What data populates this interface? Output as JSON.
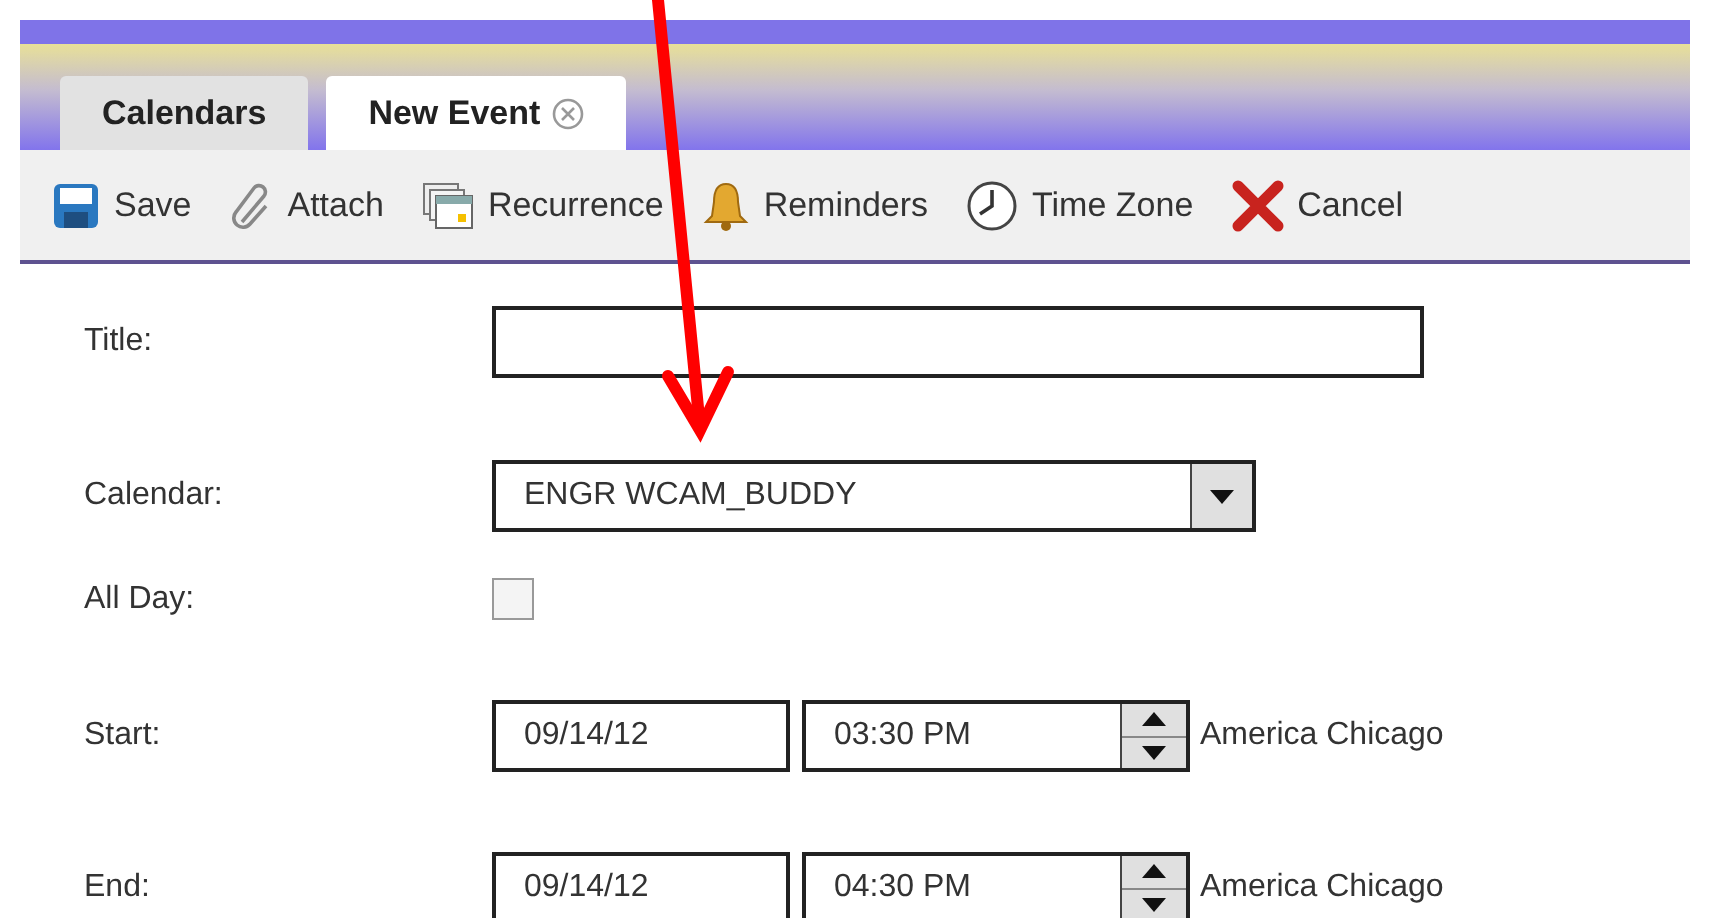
{
  "tabs": [
    {
      "label": "Calendars",
      "selected": false,
      "closable": false
    },
    {
      "label": "New Event",
      "selected": true,
      "closable": true
    }
  ],
  "toolbar": [
    {
      "kind": "save",
      "label": "Save"
    },
    {
      "kind": "attach",
      "label": "Attach"
    },
    {
      "kind": "recurrence",
      "label": "Recurrence"
    },
    {
      "kind": "reminders",
      "label": "Reminders"
    },
    {
      "kind": "timezone",
      "label": "Time Zone"
    },
    {
      "kind": "cancel",
      "label": "Cancel"
    }
  ],
  "form": [
    {
      "kind": "text",
      "label": "Title:"
    },
    {
      "kind": "select",
      "label": "Calendar:",
      "value": "ENGR WCAM_BUDDY"
    },
    {
      "kind": "checkbox",
      "label": "All Day:",
      "checked": false
    },
    {
      "kind": "datetime",
      "label": "Start:",
      "date": "09/14/12",
      "time": "03:30 PM",
      "zone": "America Chicago"
    },
    {
      "kind": "datetime",
      "label": "End:",
      "date": "09/14/12",
      "time": "04:30 PM",
      "zone": "America Chicago"
    }
  ]
}
